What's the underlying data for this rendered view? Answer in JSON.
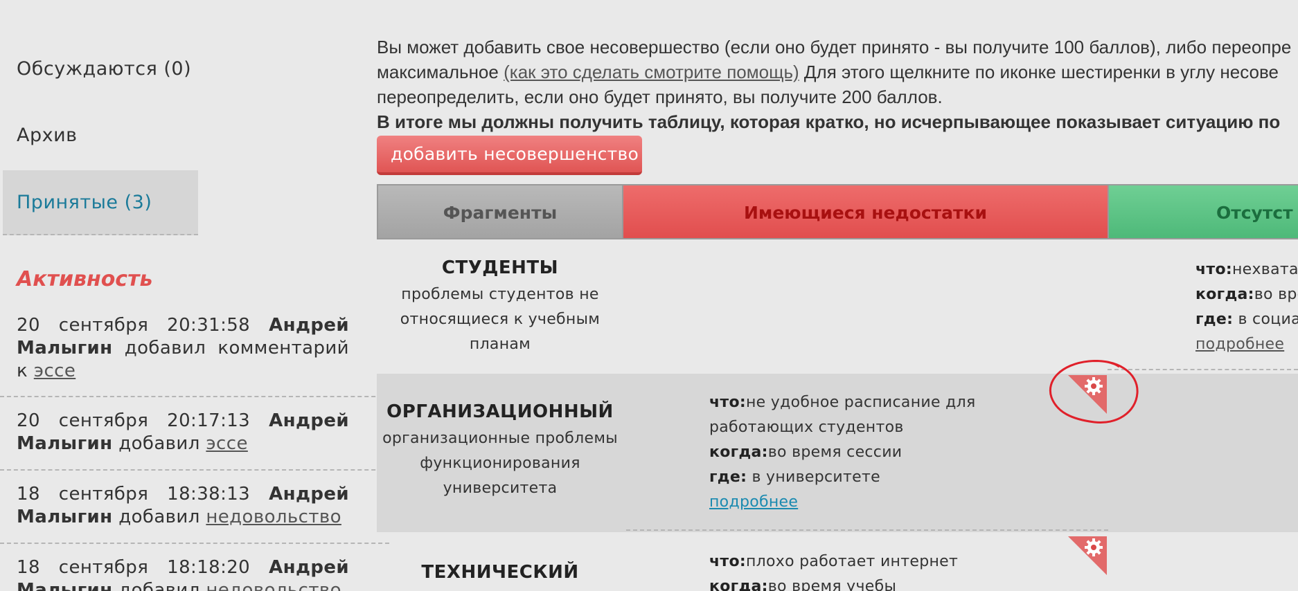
{
  "sidebar": {
    "nav": [
      {
        "label": "Обсуждаются (0)"
      },
      {
        "label": "Архив"
      },
      {
        "label": "Принятые (3)"
      }
    ],
    "activity_heading": "Активность",
    "activity": [
      {
        "date": "20 сентября 20:31:58",
        "user": "Андрей Малыгин",
        "action": "добавил комментарий к",
        "link": "эссе"
      },
      {
        "date": "20 сентября 20:17:13",
        "user": "Андрей Малыгин",
        "action": "добавил",
        "link": "эссе"
      },
      {
        "date": "18 сентября 18:38:13",
        "user": "Андрей Малыгин",
        "action": "добавил",
        "link": "недовольство"
      },
      {
        "date": "18 сентября 18:18:20",
        "user": "Андрей Малыгин",
        "action": "добавил",
        "link": "недовольство"
      }
    ]
  },
  "intro": {
    "line1": "Вы может добавить свое несовершество (если оно будет принято - вы получите 100 баллов), либо переопре",
    "line2_pre": "максимальное",
    "line2_link": "(как это сделать смотрите помощь)",
    "line2_post": "Для этого щелкните по иконке шестиренки в углу несове",
    "line3": "переопределить, если оно будет принято, вы получите 200 баллов.",
    "line4": "В итоге мы должны получить таблицу, которая кратко, но исчерпывающее показывает ситуацию по"
  },
  "add_button": "добавить несовершенство",
  "table": {
    "headers": {
      "fragments": "Фрагменты",
      "existing": "Имеющиеся недостатки",
      "absent": "Отсутст"
    },
    "rows": [
      {
        "title": "СТУДЕНТЫ",
        "desc": "проблемы студентов не относящиеся к учебным планам",
        "absent": {
          "what_label": "что:",
          "what": "нехвата",
          "when_label": "когда:",
          "when": "во вре",
          "where_label": "где:",
          "where": "в социа",
          "more": "подробнее"
        }
      },
      {
        "title": "ОРГАНИЗАЦИОННЫЙ",
        "desc": "организационные проблемы функционирования университета",
        "existing": {
          "what_label": "что:",
          "what": "не удобное расписание для работающих студентов",
          "when_label": "когда:",
          "when": "во время сессии",
          "where_label": "где:",
          "where": "в университете",
          "more": "подробнее"
        }
      },
      {
        "title": "ТЕХНИЧЕСКИЙ",
        "existing": {
          "what_label": "что:",
          "what": "плохо работает интернет",
          "when_label": "когда:",
          "when": "во время учебы"
        }
      }
    ]
  },
  "colors": {
    "accent_red": "#e05554",
    "link_blue": "#1a8ab0",
    "annotation_red": "#e0202a"
  },
  "icons": {
    "gear": "gear-icon"
  }
}
